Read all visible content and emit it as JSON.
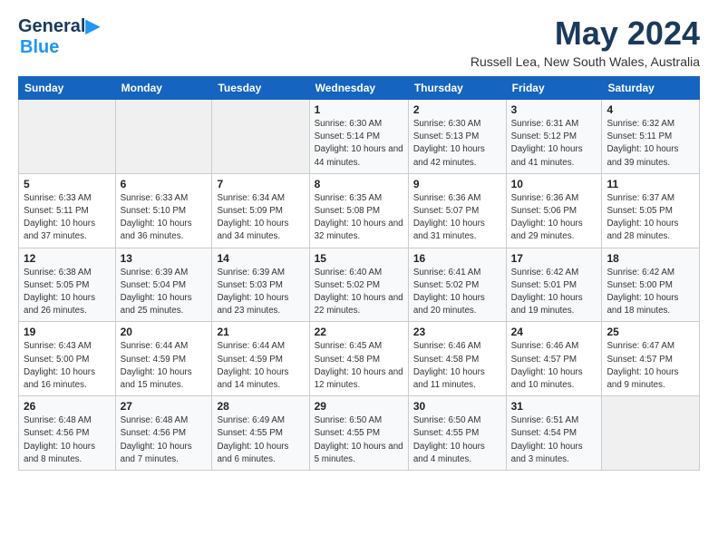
{
  "header": {
    "logo_line1": "General",
    "logo_line2": "Blue",
    "title": "May 2024",
    "subtitle": "Russell Lea, New South Wales, Australia"
  },
  "columns": [
    "Sunday",
    "Monday",
    "Tuesday",
    "Wednesday",
    "Thursday",
    "Friday",
    "Saturday"
  ],
  "weeks": [
    [
      {
        "day": "",
        "info": ""
      },
      {
        "day": "",
        "info": ""
      },
      {
        "day": "",
        "info": ""
      },
      {
        "day": "1",
        "info": "Sunrise: 6:30 AM\nSunset: 5:14 PM\nDaylight: 10 hours\nand 44 minutes."
      },
      {
        "day": "2",
        "info": "Sunrise: 6:30 AM\nSunset: 5:13 PM\nDaylight: 10 hours\nand 42 minutes."
      },
      {
        "day": "3",
        "info": "Sunrise: 6:31 AM\nSunset: 5:12 PM\nDaylight: 10 hours\nand 41 minutes."
      },
      {
        "day": "4",
        "info": "Sunrise: 6:32 AM\nSunset: 5:11 PM\nDaylight: 10 hours\nand 39 minutes."
      }
    ],
    [
      {
        "day": "5",
        "info": "Sunrise: 6:33 AM\nSunset: 5:11 PM\nDaylight: 10 hours\nand 37 minutes."
      },
      {
        "day": "6",
        "info": "Sunrise: 6:33 AM\nSunset: 5:10 PM\nDaylight: 10 hours\nand 36 minutes."
      },
      {
        "day": "7",
        "info": "Sunrise: 6:34 AM\nSunset: 5:09 PM\nDaylight: 10 hours\nand 34 minutes."
      },
      {
        "day": "8",
        "info": "Sunrise: 6:35 AM\nSunset: 5:08 PM\nDaylight: 10 hours\nand 32 minutes."
      },
      {
        "day": "9",
        "info": "Sunrise: 6:36 AM\nSunset: 5:07 PM\nDaylight: 10 hours\nand 31 minutes."
      },
      {
        "day": "10",
        "info": "Sunrise: 6:36 AM\nSunset: 5:06 PM\nDaylight: 10 hours\nand 29 minutes."
      },
      {
        "day": "11",
        "info": "Sunrise: 6:37 AM\nSunset: 5:05 PM\nDaylight: 10 hours\nand 28 minutes."
      }
    ],
    [
      {
        "day": "12",
        "info": "Sunrise: 6:38 AM\nSunset: 5:05 PM\nDaylight: 10 hours\nand 26 minutes."
      },
      {
        "day": "13",
        "info": "Sunrise: 6:39 AM\nSunset: 5:04 PM\nDaylight: 10 hours\nand 25 minutes."
      },
      {
        "day": "14",
        "info": "Sunrise: 6:39 AM\nSunset: 5:03 PM\nDaylight: 10 hours\nand 23 minutes."
      },
      {
        "day": "15",
        "info": "Sunrise: 6:40 AM\nSunset: 5:02 PM\nDaylight: 10 hours\nand 22 minutes."
      },
      {
        "day": "16",
        "info": "Sunrise: 6:41 AM\nSunset: 5:02 PM\nDaylight: 10 hours\nand 20 minutes."
      },
      {
        "day": "17",
        "info": "Sunrise: 6:42 AM\nSunset: 5:01 PM\nDaylight: 10 hours\nand 19 minutes."
      },
      {
        "day": "18",
        "info": "Sunrise: 6:42 AM\nSunset: 5:00 PM\nDaylight: 10 hours\nand 18 minutes."
      }
    ],
    [
      {
        "day": "19",
        "info": "Sunrise: 6:43 AM\nSunset: 5:00 PM\nDaylight: 10 hours\nand 16 minutes."
      },
      {
        "day": "20",
        "info": "Sunrise: 6:44 AM\nSunset: 4:59 PM\nDaylight: 10 hours\nand 15 minutes."
      },
      {
        "day": "21",
        "info": "Sunrise: 6:44 AM\nSunset: 4:59 PM\nDaylight: 10 hours\nand 14 minutes."
      },
      {
        "day": "22",
        "info": "Sunrise: 6:45 AM\nSunset: 4:58 PM\nDaylight: 10 hours\nand 12 minutes."
      },
      {
        "day": "23",
        "info": "Sunrise: 6:46 AM\nSunset: 4:58 PM\nDaylight: 10 hours\nand 11 minutes."
      },
      {
        "day": "24",
        "info": "Sunrise: 6:46 AM\nSunset: 4:57 PM\nDaylight: 10 hours\nand 10 minutes."
      },
      {
        "day": "25",
        "info": "Sunrise: 6:47 AM\nSunset: 4:57 PM\nDaylight: 10 hours\nand 9 minutes."
      }
    ],
    [
      {
        "day": "26",
        "info": "Sunrise: 6:48 AM\nSunset: 4:56 PM\nDaylight: 10 hours\nand 8 minutes."
      },
      {
        "day": "27",
        "info": "Sunrise: 6:48 AM\nSunset: 4:56 PM\nDaylight: 10 hours\nand 7 minutes."
      },
      {
        "day": "28",
        "info": "Sunrise: 6:49 AM\nSunset: 4:55 PM\nDaylight: 10 hours\nand 6 minutes."
      },
      {
        "day": "29",
        "info": "Sunrise: 6:50 AM\nSunset: 4:55 PM\nDaylight: 10 hours\nand 5 minutes."
      },
      {
        "day": "30",
        "info": "Sunrise: 6:50 AM\nSunset: 4:55 PM\nDaylight: 10 hours\nand 4 minutes."
      },
      {
        "day": "31",
        "info": "Sunrise: 6:51 AM\nSunset: 4:54 PM\nDaylight: 10 hours\nand 3 minutes."
      },
      {
        "day": "",
        "info": ""
      }
    ]
  ]
}
